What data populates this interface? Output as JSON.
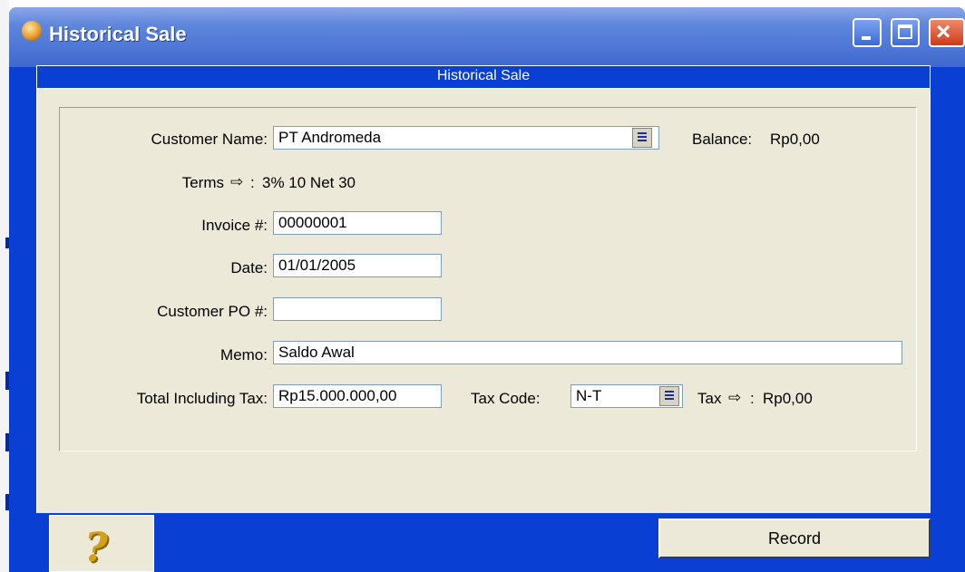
{
  "window": {
    "title": "Historical Sale"
  },
  "dialog": {
    "title": "Historical Sale"
  },
  "form": {
    "customer_name_label": "Customer Name:",
    "customer_name_value": "PT Andromeda",
    "balance_label": "Balance:",
    "balance_value": "Rp0,00",
    "terms_label": "Terms",
    "terms_arrow": "⇨",
    "terms_colon": ":",
    "terms_value": "3% 10 Net 30",
    "invoice_label": "Invoice #:",
    "invoice_value": "00000001",
    "date_label": "Date:",
    "date_value": "01/01/2005",
    "po_label": "Customer PO #:",
    "po_value": "",
    "memo_label": "Memo:",
    "memo_value": "Saldo Awal",
    "total_label": "Total Including Tax:",
    "total_value": "Rp15.000.000,00",
    "tax_code_label": "Tax Code:",
    "tax_code_value": "N-T",
    "tax_label": "Tax",
    "tax_arrow": "⇨",
    "tax_colon": ":",
    "tax_value": "Rp0,00"
  },
  "buttons": {
    "help_glyph": "?",
    "record_label": "Record"
  },
  "colors": {
    "title_blue": "#0a3fd4",
    "panel": "#ece9d8"
  },
  "icons": [
    "app-icon",
    "minimize-icon",
    "maximize-icon",
    "close-icon",
    "dropdown-icon",
    "arrow-right-icon",
    "help-icon"
  ]
}
